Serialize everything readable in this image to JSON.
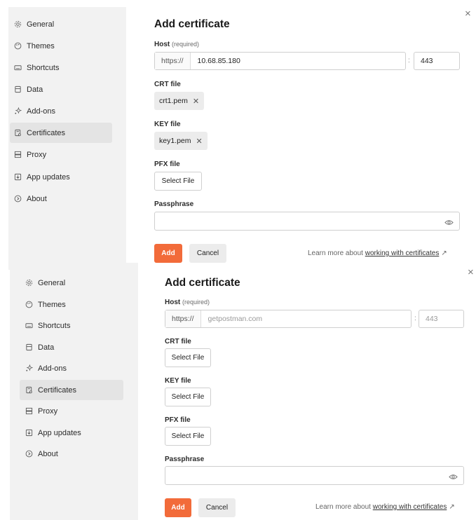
{
  "colors": {
    "accent": "#f26b3a",
    "sidebar_bg": "#f2f2f2",
    "active_bg": "#e4e4e4"
  },
  "sidebar": {
    "items": [
      {
        "label": "General",
        "icon": "gear-icon"
      },
      {
        "label": "Themes",
        "icon": "palette-icon"
      },
      {
        "label": "Shortcuts",
        "icon": "keyboard-icon"
      },
      {
        "label": "Data",
        "icon": "database-icon"
      },
      {
        "label": "Add-ons",
        "icon": "sparkle-icon"
      },
      {
        "label": "Certificates",
        "icon": "certificate-icon",
        "active": true
      },
      {
        "label": "Proxy",
        "icon": "proxy-icon"
      },
      {
        "label": "App updates",
        "icon": "download-icon"
      },
      {
        "label": "About",
        "icon": "info-icon"
      }
    ]
  },
  "top": {
    "close": "×",
    "title": "Add certificate",
    "host_label": "Host",
    "host_required": "(required)",
    "protocol": "https://",
    "host_value": "10.68.85.180",
    "colon": ":",
    "port_value": "443",
    "crt_label": "CRT file",
    "crt_file": "crt1.pem",
    "key_label": "KEY file",
    "key_file": "key1.pem",
    "pfx_label": "PFX file",
    "select_file": "Select File",
    "pass_label": "Passphrase",
    "add": "Add",
    "cancel": "Cancel",
    "learn_prefix": "Learn more about",
    "learn_link": "working with certificates",
    "learn_arrow": "↗"
  },
  "bottom": {
    "close": "×",
    "title": "Add certificate",
    "host_label": "Host",
    "host_required": "(required)",
    "protocol": "https://",
    "host_placeholder": "getpostman.com",
    "colon": ":",
    "port_placeholder": "443",
    "crt_label": "CRT file",
    "key_label": "KEY file",
    "pfx_label": "PFX file",
    "select_file": "Select File",
    "pass_label": "Passphrase",
    "add": "Add",
    "cancel": "Cancel",
    "learn_prefix": "Learn more about",
    "learn_link": "working with certificates",
    "learn_arrow": "↗"
  }
}
